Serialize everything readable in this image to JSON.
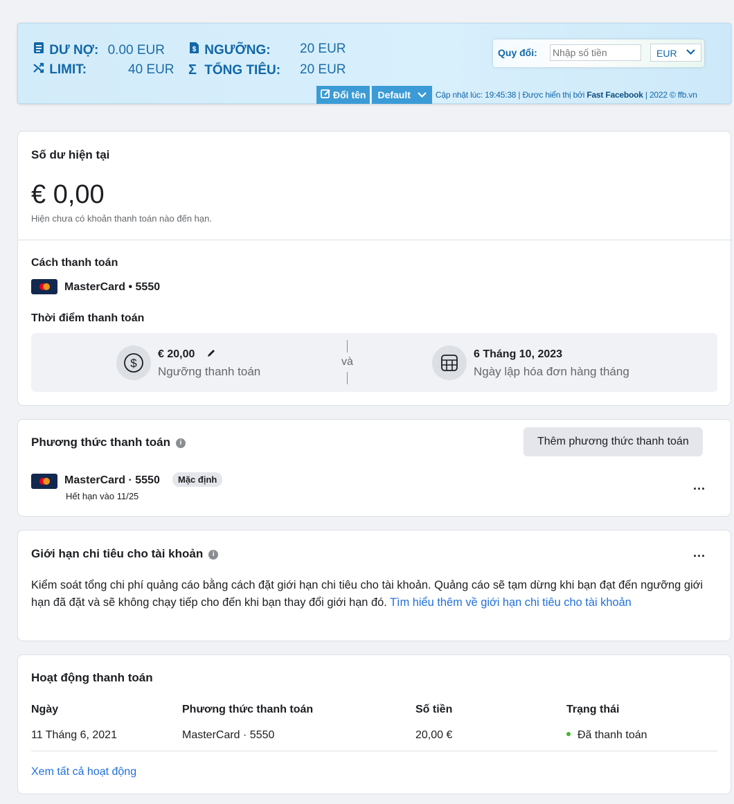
{
  "banner": {
    "debt_label": "DƯ NỢ:",
    "debt_value": "0.00 EUR",
    "threshold_label": "NGƯỠNG:",
    "threshold_value": "20 EUR",
    "limit_label": "LIMIT:",
    "limit_value": "40 EUR",
    "total_label": "TỔNG TIÊU:",
    "total_value": "20 EUR",
    "convert_label": "Quy đổi:",
    "convert_placeholder": "Nhập số tiền",
    "currency": "EUR",
    "rename_label": "Đổi tên",
    "default_label": "Default",
    "update_text": "Cập nhật lúc: 19:45:38 | Được hiển thị bởi ",
    "brand": "Fast Facebook",
    "copyright": " | 2022 © ffb.vn"
  },
  "balance": {
    "title": "Số dư hiện tại",
    "amount": "€ 0,00",
    "note": "Hiện chưa có khoản thanh toán nào đến hạn.",
    "payment_method_title": "Cách thanh toán",
    "card": "MasterCard • 5550",
    "payment_time_title": "Thời điểm thanh toán",
    "threshold_amount": "€ 20,00",
    "threshold_caption": "Ngưỡng thanh toán",
    "and": "và",
    "bill_date": "6 Tháng 10, 2023",
    "bill_caption": "Ngày lập hóa đơn hàng tháng"
  },
  "methods": {
    "title": "Phương thức thanh toán",
    "add_button": "Thêm phương thức thanh toán",
    "card": "MasterCard · 5550",
    "default_badge": "Mặc định",
    "expiry": "Hết hạn vào 11/25",
    "more": "..."
  },
  "limit": {
    "title": "Giới hạn chi tiêu cho tài khoản",
    "description": "Kiểm soát tổng chi phí quảng cáo bằng cách đặt giới hạn chi tiêu cho tài khoản. Quảng cáo sẽ tạm dừng khi bạn đạt đến ngưỡng giới hạn đã đặt và sẽ không chạy tiếp cho đến khi bạn thay đổi giới hạn đó. ",
    "learn_more": "Tìm hiểu thêm về giới hạn chi tiêu cho tài khoản",
    "more": "..."
  },
  "activity": {
    "title": "Hoạt động thanh toán",
    "headers": [
      "Ngày",
      "Phương thức thanh toán",
      "Số tiền",
      "Trạng thái"
    ],
    "rows": [
      {
        "date": "11 Tháng 6, 2021",
        "method": "MasterCard · 5550",
        "amount": "20,00 €",
        "status": "Đã thanh toán"
      }
    ],
    "view_all": "Xem tất cả hoạt động"
  },
  "colors": {
    "accent": "#1167a8",
    "link": "#216fdb",
    "paid": "#42b72a"
  }
}
